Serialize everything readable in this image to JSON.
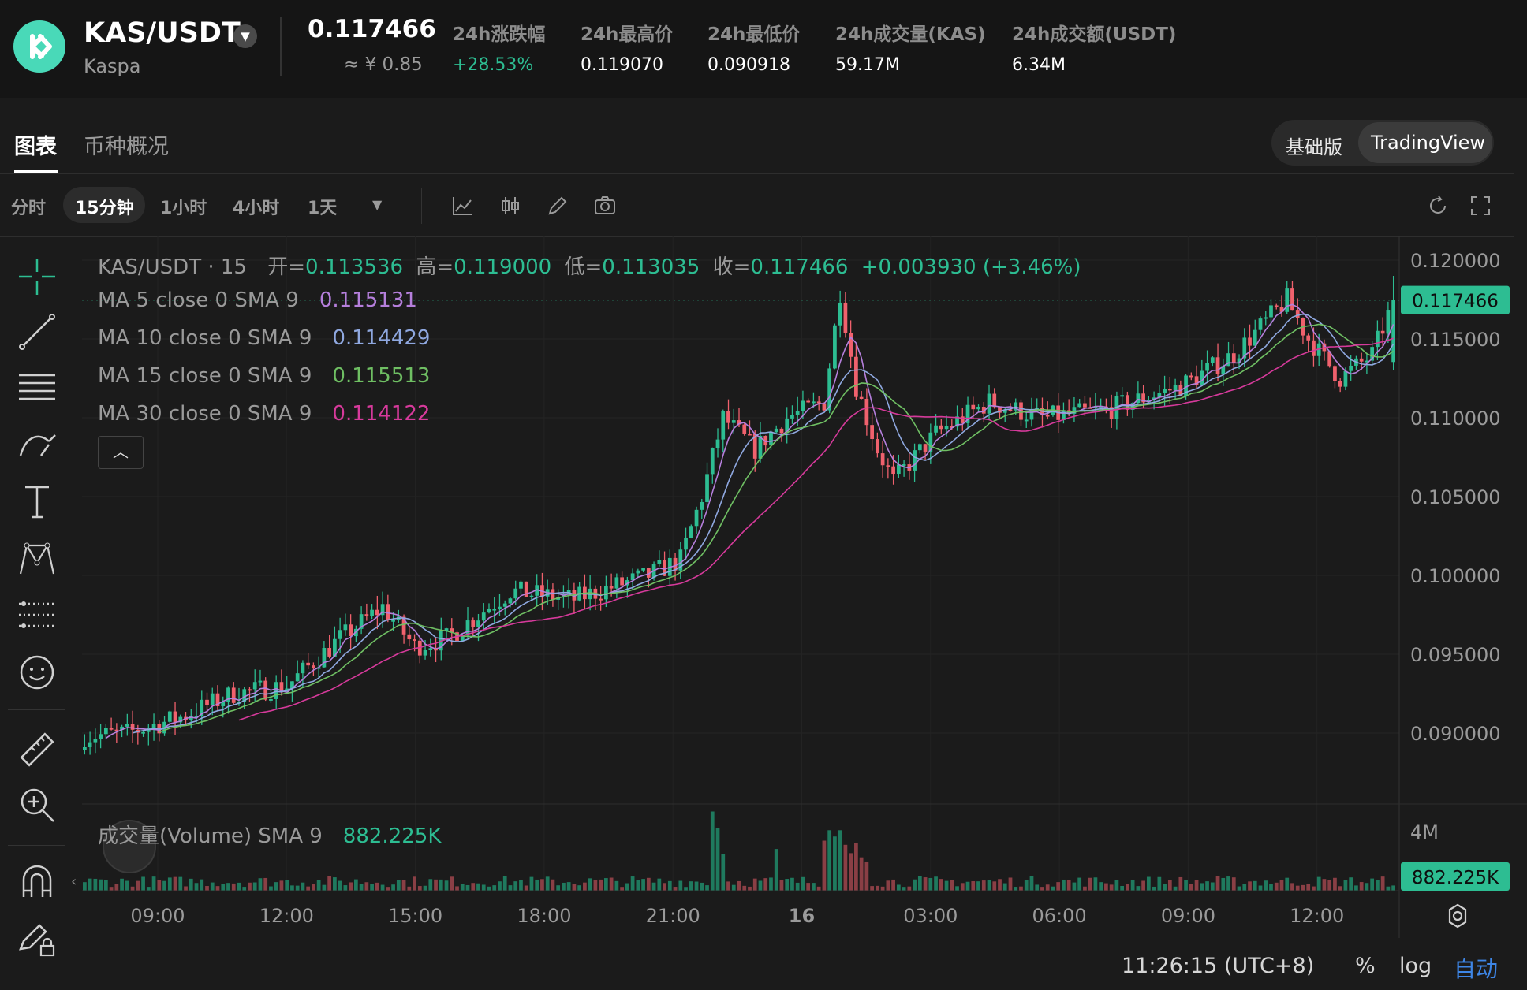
{
  "header": {
    "pair": "KAS/USDT",
    "coin_name": "Kaspa",
    "last_price": "0.117466",
    "cny_price": "≈ ¥ 0.85",
    "stats": [
      {
        "label": "24h涨跌幅",
        "value": "+28.53%"
      },
      {
        "label": "24h最高价",
        "value": "0.119070"
      },
      {
        "label": "24h最低价",
        "value": "0.090918"
      },
      {
        "label": "24h成交量(KAS)",
        "value": "59.17M"
      },
      {
        "label": "24h成交额(USDT)",
        "value": "6.34M"
      }
    ]
  },
  "tabs": {
    "chart": "图表",
    "overview": "币种概况"
  },
  "mode_switch": {
    "basic": "基础版",
    "tradingview": "TradingView"
  },
  "timeframes": [
    "分时",
    "15分钟",
    "1小时",
    "4小时",
    "1天"
  ],
  "chart_legend": {
    "symbol": "KAS/USDT · 15",
    "open_label": "开=",
    "open": "0.113536",
    "high_label": "高=",
    "high": "0.119000",
    "low_label": "低=",
    "low": "0.113035",
    "close_label": "收=",
    "close": "0.117466",
    "change": "+0.003930 (+3.46%)",
    "ma": [
      {
        "label": "MA 5 close 0 SMA 9",
        "value": "0.115131"
      },
      {
        "label": "MA 10 close 0 SMA 9",
        "value": "0.114429"
      },
      {
        "label": "MA 15 close 0 SMA 9",
        "value": "0.115513"
      },
      {
        "label": "MA 30 close 0 SMA 9",
        "value": "0.114122"
      }
    ],
    "volume_label": "成交量(Volume) SMA 9",
    "volume_value": "882.225K"
  },
  "footer": {
    "time": "11:26:15 (UTC+8)",
    "percent": "%",
    "log": "log",
    "auto": "自动"
  },
  "colors": {
    "up": "#2dbd92",
    "down": "#f0616d",
    "ma5": "#b57fdc",
    "ma10": "#8fa8e0",
    "ma15": "#6fbf63",
    "ma30": "#d63a9b",
    "accent": "#2dbd92"
  },
  "chart_data": {
    "type": "candlestick",
    "title": "KAS/USDT · 15",
    "interval": "15",
    "x_ticks": [
      "09:00",
      "12:00",
      "15:00",
      "18:00",
      "21:00",
      "16",
      "03:00",
      "06:00",
      "09:00",
      "12:00"
    ],
    "y_ticks": [
      "0.120000",
      "0.115000",
      "0.110000",
      "0.105000",
      "0.100000",
      "0.095000",
      "0.090000"
    ],
    "ylim": [
      0.0855,
      0.1215
    ],
    "volume_ticks": [
      "4M"
    ],
    "volume_max": 4000000,
    "last_price_label": "0.117466",
    "last_volume_label": "882.225K",
    "knots": [
      [
        0,
        0.0898
      ],
      [
        8,
        0.09
      ],
      [
        18,
        0.091
      ],
      [
        28,
        0.0925
      ],
      [
        38,
        0.093
      ],
      [
        48,
        0.096
      ],
      [
        56,
        0.098
      ],
      [
        62,
        0.0955
      ],
      [
        68,
        0.096
      ],
      [
        80,
        0.099
      ],
      [
        92,
        0.0985
      ],
      [
        106,
        0.1
      ],
      [
        112,
        0.101
      ],
      [
        116,
        0.105
      ],
      [
        120,
        0.11
      ],
      [
        126,
        0.108
      ],
      [
        132,
        0.11
      ],
      [
        139,
        0.111
      ],
      [
        142,
        0.118
      ],
      [
        145,
        0.112
      ],
      [
        149,
        0.108
      ],
      [
        152,
        0.106
      ],
      [
        160,
        0.109
      ],
      [
        170,
        0.111
      ],
      [
        180,
        0.11
      ],
      [
        192,
        0.1105
      ],
      [
        206,
        0.112
      ],
      [
        216,
        0.114
      ],
      [
        226,
        0.1175
      ],
      [
        230,
        0.115
      ],
      [
        236,
        0.1125
      ],
      [
        242,
        0.114
      ],
      [
        246,
        0.1174
      ]
    ],
    "volume_spikes": [
      [
        118,
        1900000
      ],
      [
        119,
        1500000
      ],
      [
        120,
        880000
      ],
      [
        130,
        1000000
      ],
      [
        139,
        1200000
      ],
      [
        140,
        1450000
      ],
      [
        141,
        1300000
      ],
      [
        142,
        1450000
      ],
      [
        143,
        1100000
      ],
      [
        144,
        900000
      ],
      [
        145,
        1150000
      ],
      [
        146,
        800000
      ],
      [
        147,
        700000
      ]
    ],
    "series": [
      {
        "name": "MA 5 close 0 SMA 9",
        "period": 5,
        "last": 0.115131
      },
      {
        "name": "MA 10 close 0 SMA 9",
        "period": 10,
        "last": 0.114429
      },
      {
        "name": "MA 15 close 0 SMA 9",
        "period": 15,
        "last": 0.115513
      },
      {
        "name": "MA 30 close 0 SMA 9",
        "period": 30,
        "last": 0.114122
      }
    ]
  }
}
